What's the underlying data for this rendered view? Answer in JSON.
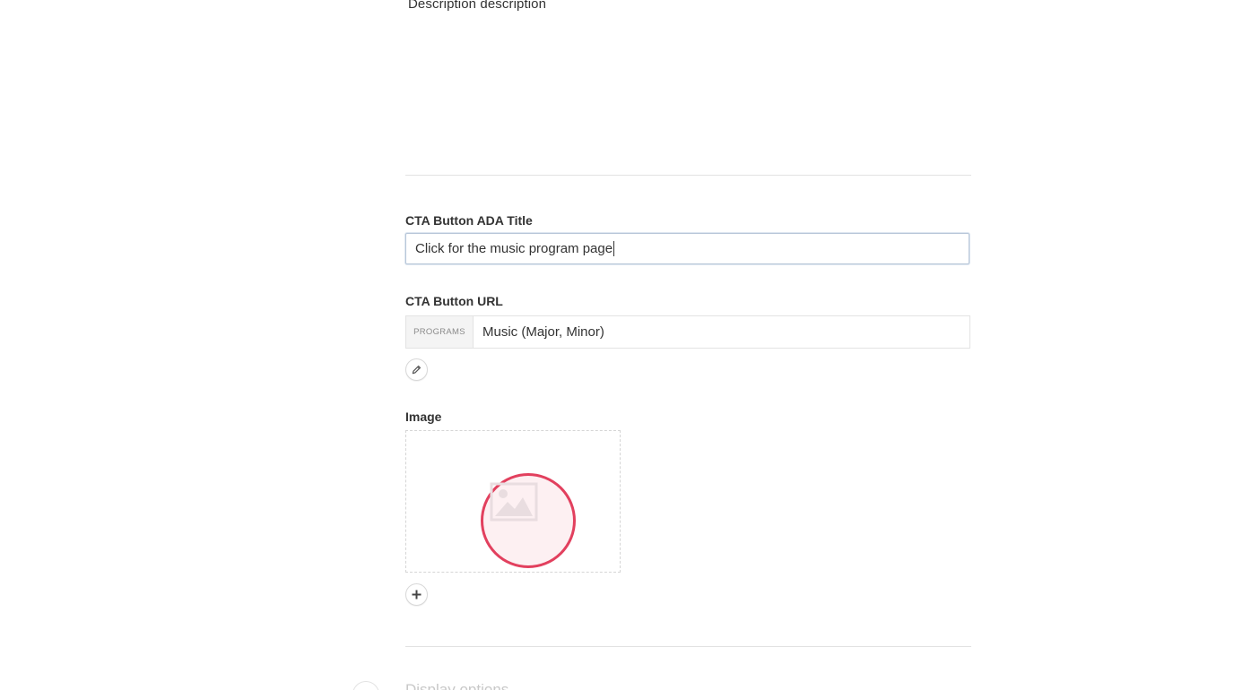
{
  "description": {
    "text": "Description description"
  },
  "cta_title": {
    "label": "CTA Button ADA Title",
    "value": "Click for the music program page"
  },
  "cta_url": {
    "label": "CTA Button URL",
    "prefix": "PROGRAMS",
    "value": "Music (Major, Minor)",
    "edit_icon": "pencil-icon"
  },
  "image": {
    "label": "Image",
    "placeholder_icon": "image-placeholder-icon",
    "add_icon": "plus-icon",
    "highlight_color": "#e2405e"
  },
  "next_section": {
    "label": "Display options"
  }
}
